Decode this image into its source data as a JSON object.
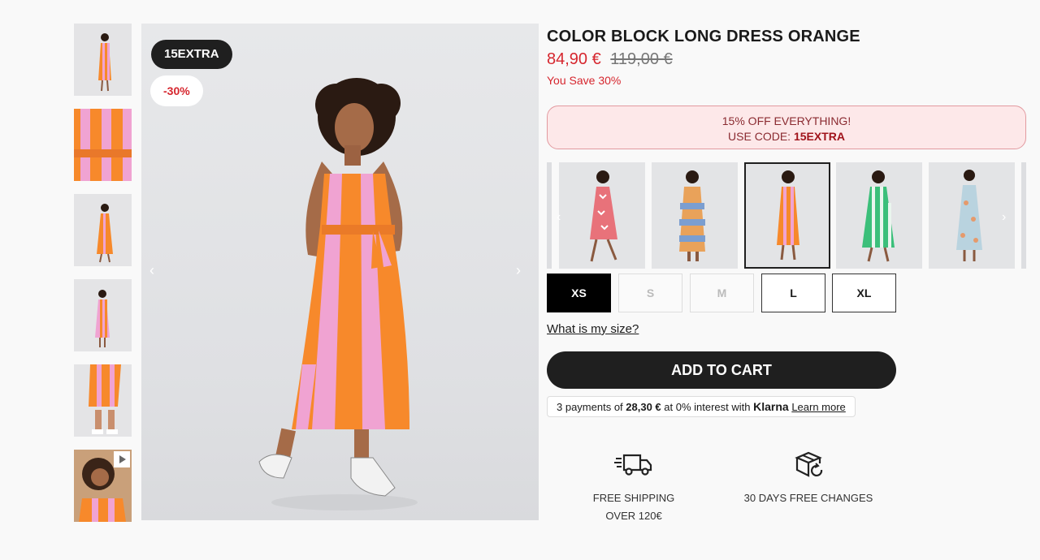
{
  "product": {
    "title": "COLOR BLOCK LONG DRESS ORANGE",
    "price_now": "84,90 €",
    "price_old": "119,00 €",
    "you_save": "You Save 30%"
  },
  "badges": {
    "code": "15EXTRA",
    "discount": "-30%"
  },
  "promo": {
    "line1": "15% OFF EVERYTHING!",
    "line2_prefix": "USE CODE: ",
    "code": "15EXTRA"
  },
  "variants": [
    "pink-red print",
    "blue-orange stripe",
    "orange-pink stripe",
    "green-white stripe",
    "blue floral"
  ],
  "sizes": [
    {
      "label": "XS",
      "state": "selected"
    },
    {
      "label": "S",
      "state": "unavailable"
    },
    {
      "label": "M",
      "state": "unavailable"
    },
    {
      "label": "L",
      "state": "available"
    },
    {
      "label": "XL",
      "state": "available"
    }
  ],
  "links": {
    "what_size": "What is my size?"
  },
  "cart": {
    "add_label": "ADD TO CART"
  },
  "klarna": {
    "prefix": "3 payments of ",
    "amount": "28,30 €",
    "middle": " at 0% interest with ",
    "brand": "Klarna",
    "learn_more": "Learn more"
  },
  "features": {
    "shipping_line1": "FREE SHIPPING",
    "shipping_line2": "OVER 120€",
    "changes": "30 DAYS FREE CHANGES"
  },
  "colors": {
    "accent_red": "#d6262e",
    "dark": "#1f1f1f",
    "promo_bg": "#fde8e9",
    "dress_orange": "#f7892b",
    "dress_pink": "#f0a3d2"
  },
  "icons": [
    "chevron-left-icon",
    "chevron-right-icon",
    "play-icon",
    "truck-icon",
    "box-return-icon"
  ]
}
